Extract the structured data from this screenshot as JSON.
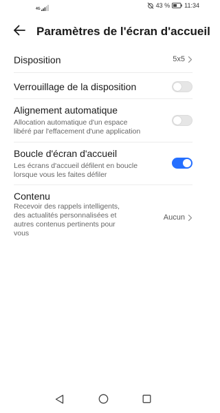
{
  "status_bar": {
    "network_label": "4G",
    "battery_percent": "43 %",
    "time": "11:34",
    "icons": [
      "signal-icon",
      "alarm-off-icon",
      "battery-icon"
    ]
  },
  "header": {
    "title": "Paramètres de l'écran d'accueil",
    "back_icon": "back-arrow-icon"
  },
  "settings": {
    "disposition": {
      "title": "Disposition",
      "value": "5x5"
    },
    "verrouillage": {
      "title": "Verrouillage de la disposition",
      "enabled": false
    },
    "alignement": {
      "title": "Alignement automatique",
      "subtitle_line1": "Allocation automatique d'un espace",
      "subtitle_line2": "libéré par l'effacement d'une application",
      "enabled": false
    },
    "boucle": {
      "title": "Boucle d'écran d'accueil",
      "subtitle_line1": "Les écrans d'accueil défilent en boucle",
      "subtitle_line2": "lorsque vous les faites défiler",
      "enabled": true
    },
    "contenu": {
      "title": "Contenu",
      "subtitle_line1": "Recevoir des rappels intelligents,",
      "subtitle_line2": "des actualités personnalisées et",
      "subtitle_line3": "autres contenus pertinents pour",
      "subtitle_line4": "vous",
      "value": "Aucun"
    }
  },
  "colors": {
    "accent": "#256fff",
    "toggle_off": "#e6e6e6",
    "divider": "#ececec"
  },
  "nav_bar": {
    "icons": [
      "back-triangle-icon",
      "home-circle-icon",
      "recents-square-icon"
    ]
  }
}
